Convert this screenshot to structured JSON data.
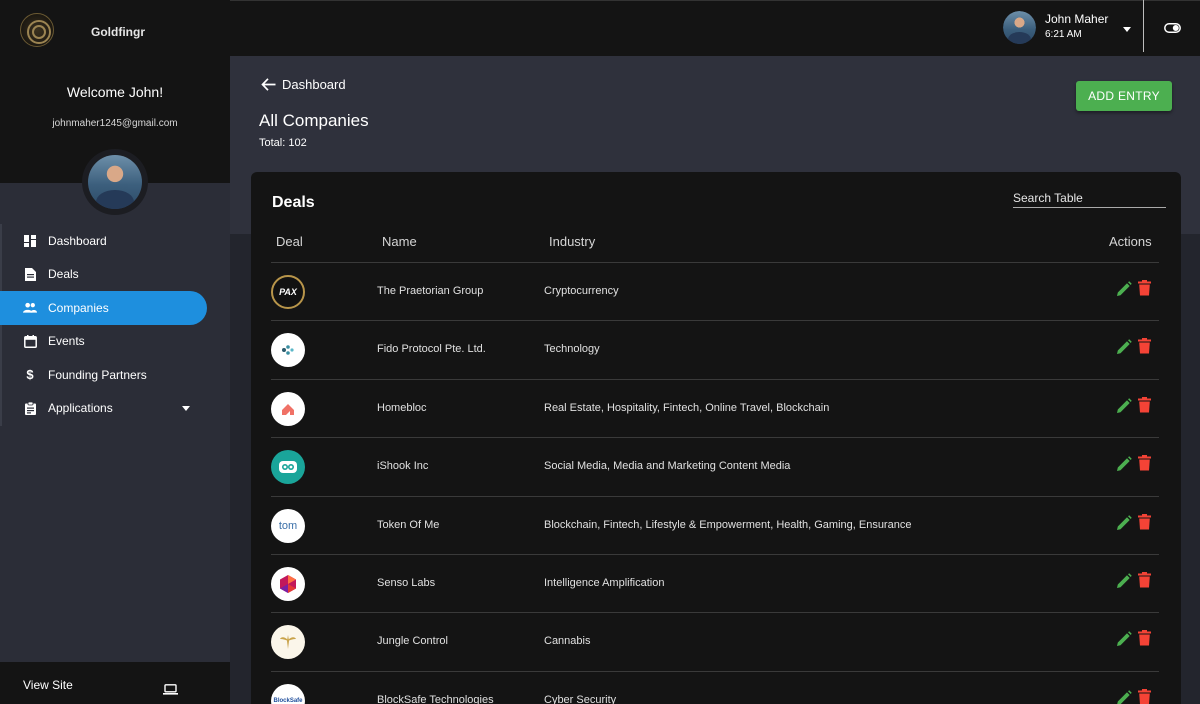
{
  "sidebar": {
    "brand_name": "Goldfingr",
    "welcome": "Welcome John!",
    "email": "johnmaher1245@gmail.com",
    "items": [
      {
        "label": "Dashboard",
        "icon": "dashboard-icon"
      },
      {
        "label": "Deals",
        "icon": "document-icon"
      },
      {
        "label": "Companies",
        "icon": "people-icon",
        "active": true
      },
      {
        "label": "Events",
        "icon": "calendar-icon"
      },
      {
        "label": "Founding Partners",
        "icon": "dollar-icon"
      },
      {
        "label": "Applications",
        "icon": "clipboard-icon"
      }
    ],
    "view_site": "View Site"
  },
  "topbar": {
    "user_name": "John Maher",
    "time": "6:21 AM"
  },
  "header": {
    "back_label": "Dashboard",
    "title": "All Companies",
    "total": "Total: 102",
    "add_button": "ADD ENTRY"
  },
  "table": {
    "title": "Deals",
    "search_placeholder": "Search Table",
    "columns": [
      "Deal",
      "Name",
      "Industry",
      "Actions"
    ],
    "rows": [
      {
        "name": "The Praetorian Group",
        "industry": "Cryptocurrency",
        "logo_text": "PAX"
      },
      {
        "name": "Fido Protocol Pte. Ltd.",
        "industry": "Technology",
        "logo_text": ""
      },
      {
        "name": "Homebloc",
        "industry": "Real Estate, Hospitality, Fintech, Online Travel, Blockchain",
        "logo_text": ""
      },
      {
        "name": "iShook Inc",
        "industry": "Social Media, Media and Marketing Content Media",
        "logo_text": ""
      },
      {
        "name": "Token Of Me",
        "industry": "Blockchain, Fintech, Lifestyle & Empowerment, Health, Gaming, Ensurance",
        "logo_text": "tom"
      },
      {
        "name": "Senso Labs",
        "industry": "Intelligence Amplification",
        "logo_text": ""
      },
      {
        "name": "Jungle Control",
        "industry": "Cannabis",
        "logo_text": ""
      },
      {
        "name": "BlockSafe Technologies",
        "industry": "Cyber Security",
        "logo_text": "BlockSafe"
      }
    ]
  },
  "colors": {
    "accent": "#1e8fde",
    "add_button": "#4caf50",
    "edit": "#4caf50",
    "delete": "#f44336"
  }
}
